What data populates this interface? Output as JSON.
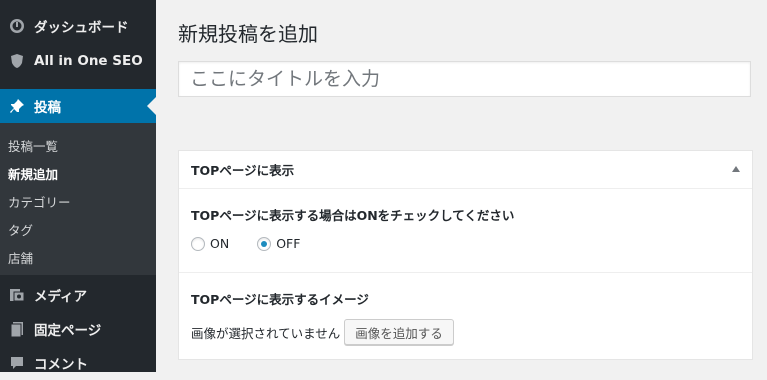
{
  "sidebar": {
    "top_items": [
      {
        "label": "ダッシュボード",
        "icon": "dashboard-icon"
      },
      {
        "label": "All in One SEO",
        "icon": "shield-icon"
      },
      {
        "label": "投稿",
        "icon": "pin-icon"
      }
    ],
    "submenu": [
      {
        "label": "投稿一覧"
      },
      {
        "label": "新規追加"
      },
      {
        "label": "カテゴリー"
      },
      {
        "label": "タグ"
      },
      {
        "label": "店舗"
      }
    ],
    "bottom_items": [
      {
        "label": "メディア",
        "icon": "media-icon"
      },
      {
        "label": "固定ページ",
        "icon": "page-icon"
      },
      {
        "label": "コメント",
        "icon": "comment-icon"
      }
    ]
  },
  "main": {
    "title": "新規投稿を追加",
    "title_placeholder": "ここにタイトルを入力",
    "metabox": {
      "header": "TOPページに表示",
      "toggle_label": "TOPページに表示する場合はONをチェックしてください",
      "options": [
        {
          "label": "ON",
          "selected": false
        },
        {
          "label": "OFF",
          "selected": true
        }
      ],
      "image_label": "TOPページに表示するイメージ",
      "image_status": "画像が選択されていません",
      "add_image_button": "画像を追加する"
    }
  },
  "colors": {
    "sidebar_bg": "#23282d",
    "accent": "#0073aa",
    "radio_checked": "#1e8cbe"
  }
}
